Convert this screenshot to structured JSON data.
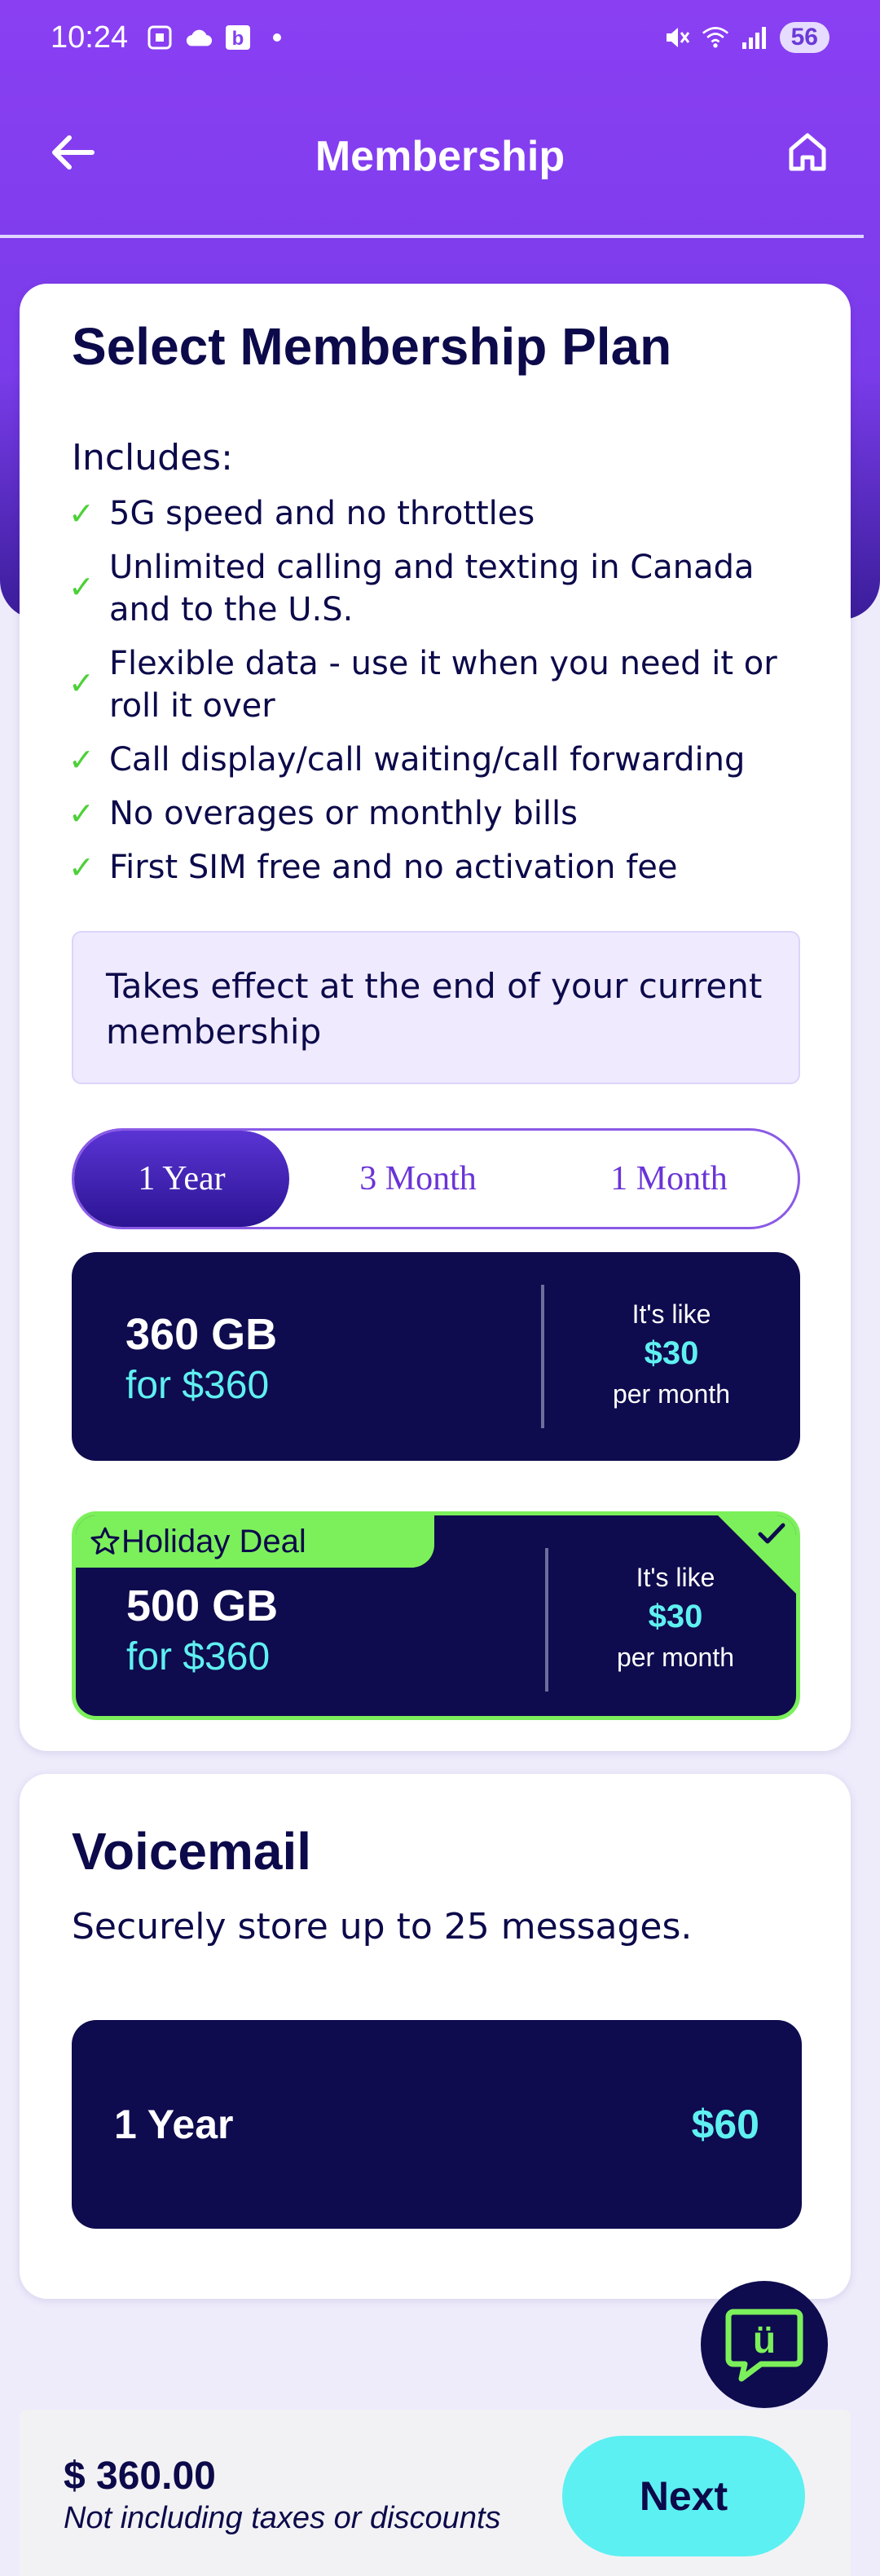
{
  "status_bar": {
    "time": "10:24",
    "battery": "56",
    "icons_left": [
      "screenshot-icon",
      "cloud-icon",
      "b-app-icon",
      "dot-icon"
    ],
    "icons_right": [
      "mute-icon",
      "wifi-icon",
      "signal-icon"
    ]
  },
  "header": {
    "title": "Membership",
    "back_icon": "arrow-left-icon",
    "home_icon": "home-icon"
  },
  "plan": {
    "title": "Select Membership Plan",
    "includes_label": "Includes:",
    "features": [
      "5G speed and no throttles",
      "Unlimited calling and texting in Canada and to the U.S.",
      "Flexible data - use it when you need it or roll it over",
      "Call display/call waiting/call forwarding",
      "No overages or monthly bills",
      "First SIM free and no activation fee"
    ],
    "notice": "Takes effect at the end of your current membership",
    "terms": [
      "1 Year",
      "3 Month",
      "1 Month"
    ],
    "selected_term": "1 Year",
    "offers": [
      {
        "data": "360 GB",
        "price": "for $360",
        "like_label": "It's like",
        "like_price": "$30",
        "per": "per month"
      },
      {
        "badge": "Holiday Deal",
        "data": "500 GB",
        "price": "for $360",
        "like_label": "It's like",
        "like_price": "$30",
        "per": "per month",
        "selected": true
      }
    ]
  },
  "voicemail": {
    "title": "Voicemail",
    "description": "Securely store up to 25 messages.",
    "option_term": "1 Year",
    "option_price": "$60"
  },
  "footer": {
    "total": "$ 360.00",
    "note": "Not including taxes or discounts",
    "next_label": "Next"
  },
  "colors": {
    "header_purple": "#7f3ff0",
    "navy": "#0e0b4e",
    "accent_cyan": "#5ff0f0",
    "deal_green": "#7cf05b",
    "check_green": "#4cd137"
  }
}
